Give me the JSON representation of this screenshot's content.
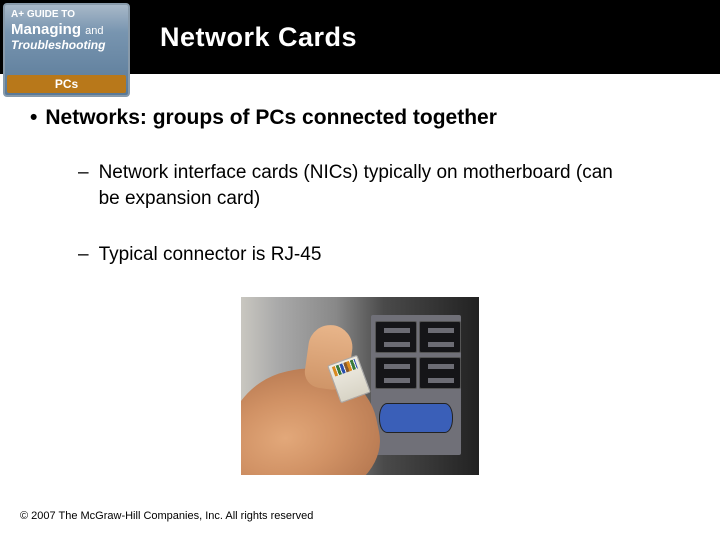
{
  "logo": {
    "topline": "A+ GUIDE TO",
    "line1": "Managing",
    "join": "and",
    "line2": "Troubleshooting",
    "pcs": "PCs"
  },
  "header": {
    "title": "Network Cards"
  },
  "bullets": {
    "main": "Networks: groups of PCs connected together",
    "sub1": "Network interface cards (NICs) typically on motherboard (can be expansion card)",
    "sub2": "Typical connector is RJ-45"
  },
  "footer": {
    "copyright": "© 2007 The McGraw-Hill Companies, Inc. All rights reserved"
  }
}
